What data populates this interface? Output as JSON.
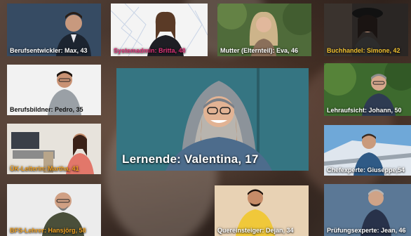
{
  "colors": {
    "label_default": "#ffffff",
    "label_pink": "#e0337a",
    "label_yellow": "#f2c230",
    "label_orange": "#f0a020",
    "featured_bg": "#3b7f8c"
  },
  "cards": [
    {
      "id": "max",
      "label": "Berufsentwickler: Max, 43",
      "label_color": "#ffffff",
      "icon": "person-photo"
    },
    {
      "id": "britta",
      "label": "Systemadmin: Britta, 48",
      "label_color": "#e0337a",
      "icon": "person-photo"
    },
    {
      "id": "eva",
      "label": "Mutter (Elternteil): Eva, 46",
      "label_color": "#ffffff",
      "icon": "person-photo"
    },
    {
      "id": "simone",
      "label": "Buchhandel: Simone, 42",
      "label_color": "#f2c230",
      "icon": "person-photo"
    },
    {
      "id": "pedro",
      "label": "Berufsbildner: Pedro, 35",
      "label_color": "#ffffff",
      "icon": "person-photo"
    },
    {
      "id": "valentina",
      "label": "Lernende: Valentina, 17",
      "label_color": "#ffffff",
      "icon": "person-photo"
    },
    {
      "id": "johann",
      "label": "Lehraufsicht: Johann, 50",
      "label_color": "#ffffff",
      "icon": "person-photo"
    },
    {
      "id": "martha",
      "label": "ÜK-Leiterin: Martha, 41",
      "label_color": "#f0a020",
      "icon": "person-photo"
    },
    {
      "id": "giuseppe",
      "label": "Chefexperte: Giuseppe,54",
      "label_color": "#ffffff",
      "icon": "person-photo"
    },
    {
      "id": "hansjoerg",
      "label": "BFS-Lehrer: Hansjörg, 58",
      "label_color": "#f0a020",
      "icon": "person-photo"
    },
    {
      "id": "dejan",
      "label": "Quereinsteiger: Dejan, 34",
      "label_color": "#ffffff",
      "icon": "person-photo"
    },
    {
      "id": "jean",
      "label": "Prüfungsexperte: Jean, 46",
      "label_color": "#ffffff",
      "icon": "person-photo"
    }
  ]
}
